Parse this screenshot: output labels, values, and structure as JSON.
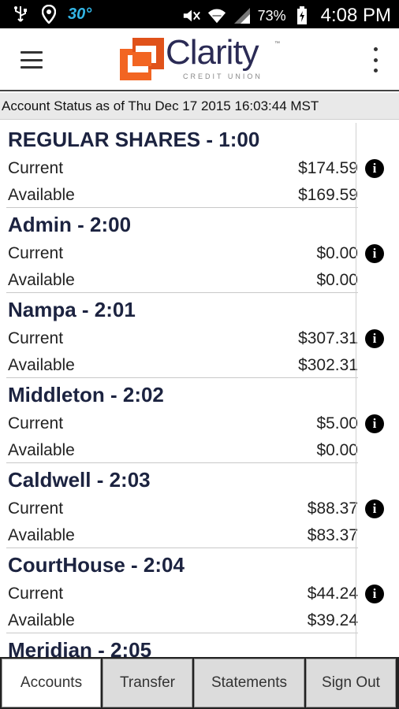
{
  "status_bar": {
    "icons_left": [
      "usb-icon",
      "location-icon"
    ],
    "temperature": "30°",
    "icons_right": [
      "mute-icon",
      "wifi-icon",
      "signal-icon",
      "battery-icon"
    ],
    "battery_percent": "73%",
    "time": "4:08 PM"
  },
  "app_bar": {
    "logo_text": "Clarity",
    "logo_subtext": "CREDIT UNION",
    "logo_tm": "™",
    "brand_color": "#f26522",
    "menu_icon": "hamburger-menu-icon",
    "overflow_icon": "more-vertical-icon"
  },
  "status_line": "Account Status as of Thu Dec 17 2015 16:03:44 MST",
  "labels": {
    "current": "Current",
    "available": "Available",
    "info": "i"
  },
  "accounts": [
    {
      "name": "REGULAR SHARES - 1:00",
      "current": "$174.59",
      "available": "$169.59"
    },
    {
      "name": "Admin - 2:00",
      "current": "$0.00",
      "available": "$0.00"
    },
    {
      "name": "Nampa - 2:01",
      "current": "$307.31",
      "available": "$302.31"
    },
    {
      "name": "Middleton - 2:02",
      "current": "$5.00",
      "available": "$0.00"
    },
    {
      "name": "Caldwell - 2:03",
      "current": "$88.37",
      "available": "$83.37"
    },
    {
      "name": "CourtHouse - 2:04",
      "current": "$44.24",
      "available": "$39.24"
    },
    {
      "name": "Meridian - 2:05",
      "current": "",
      "available": ""
    }
  ],
  "tabs": [
    {
      "label": "Accounts",
      "active": true
    },
    {
      "label": "Transfer",
      "active": false
    },
    {
      "label": "Statements",
      "active": false
    },
    {
      "label": "Sign Out",
      "active": false
    }
  ]
}
